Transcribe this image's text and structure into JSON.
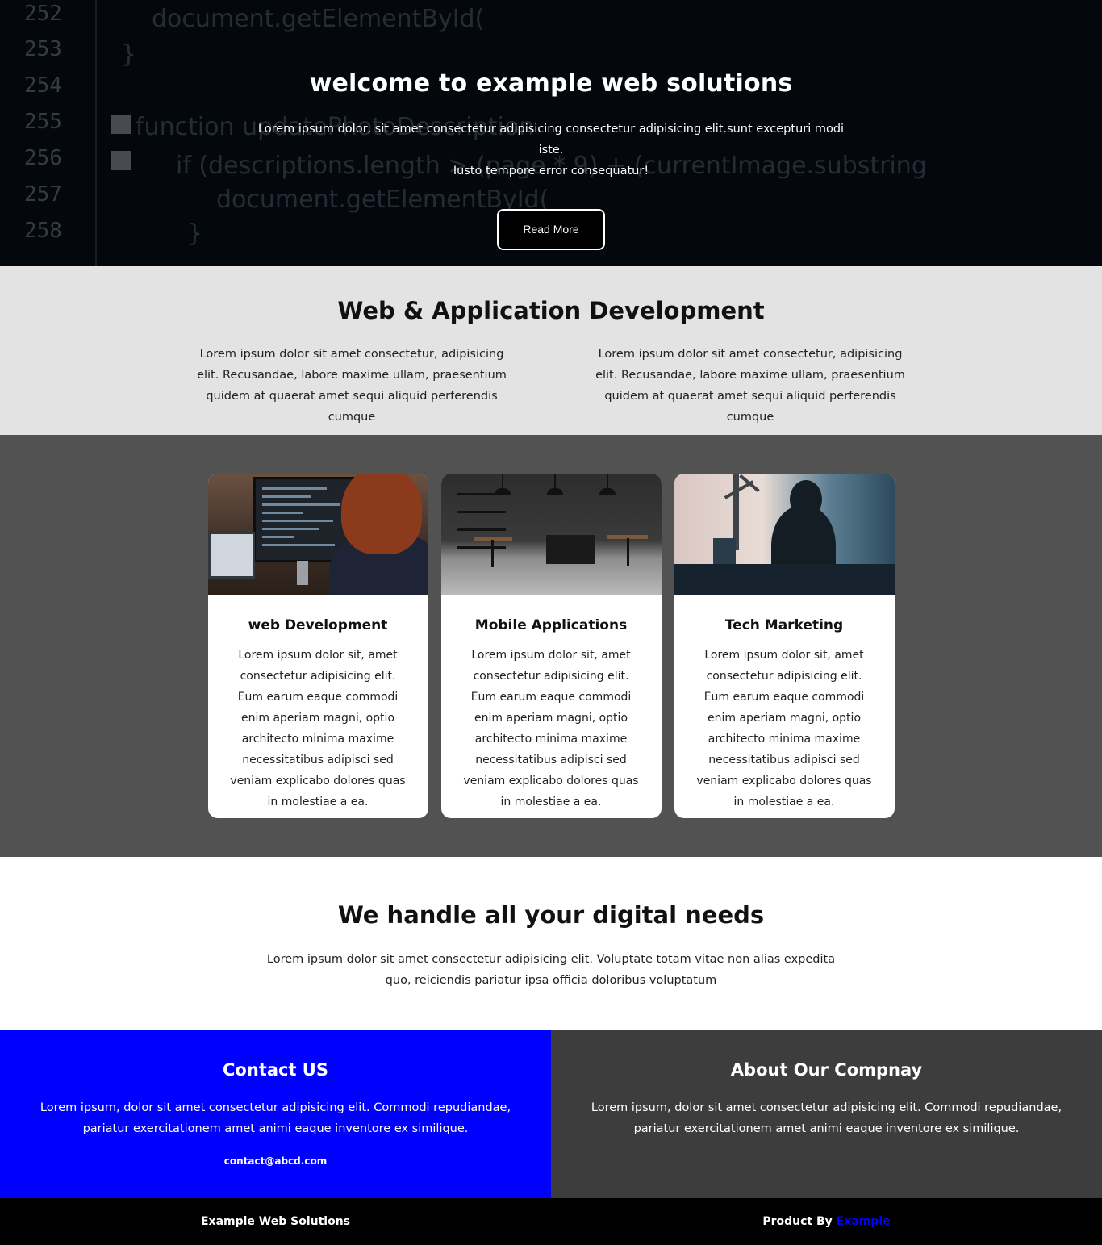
{
  "hero": {
    "title": "welcome to example web solutions",
    "text_line1": "Lorem ipsum dolor, sit amet consectetur adipisicing consectetur adipisicing elit.sunt excepturi modi iste.",
    "text_line2": "Iusto tempore error consequatur!",
    "button": "Read More",
    "code_lines": [
      {
        "no": "252",
        "code": "document.getElementById("
      },
      {
        "no": "253",
        "code": "}"
      },
      {
        "no": "254",
        "code": ""
      },
      {
        "no": "255",
        "code": "function updatePhotoDescription"
      },
      {
        "no": "256",
        "code": "if (descriptions.length > (page * 9) + (currentImage.substring"
      },
      {
        "no": "257",
        "code": "document.getElementById("
      },
      {
        "no": "258",
        "code": "}"
      }
    ]
  },
  "dev": {
    "title": "Web & Application Development",
    "columns": [
      "Lorem ipsum dolor sit amet consectetur, adipisicing elit. Recusandae, labore maxime ullam, praesentium quidem at quaerat amet sequi aliquid perferendis cumque",
      "Lorem ipsum dolor sit amet consectetur, adipisicing elit. Recusandae, labore maxime ullam, praesentium quidem at quaerat amet sequi aliquid perferendis cumque"
    ]
  },
  "cards": [
    {
      "title": "web Development",
      "text": "Lorem ipsum dolor sit, amet consectetur adipisicing elit. Eum earum eaque commodi enim aperiam magni, optio architecto minima maxime necessitatibus adipisci sed veniam explicabo dolores quas in molestiae a ea."
    },
    {
      "title": "Mobile Applications",
      "text": "Lorem ipsum dolor sit, amet consectetur adipisicing elit. Eum earum eaque commodi enim aperiam magni, optio architecto minima maxime necessitatibus adipisci sed veniam explicabo dolores quas in molestiae a ea."
    },
    {
      "title": "Tech Marketing",
      "text": "Lorem ipsum dolor sit, amet consectetur adipisicing elit. Eum earum eaque commodi enim aperiam magni, optio architecto minima maxime necessitatibus adipisci sed veniam explicabo dolores quas in molestiae a ea."
    }
  ],
  "digital": {
    "title": "We handle all your digital needs",
    "text": "Lorem ipsum dolor sit amet consectetur adipisicing elit. Voluptate totam vitae non alias expedita quo, reiciendis pariatur ipsa officia doloribus voluptatum"
  },
  "contact": {
    "title": "Contact US",
    "text": "Lorem ipsum, dolor sit amet consectetur adipisicing elit. Commodi repudiandae, pariatur exercitationem amet animi eaque inventore ex similique.",
    "email": "contact@abcd.com"
  },
  "about": {
    "title": "About Our Compnay",
    "text": "Lorem ipsum, dolor sit amet consectetur adipisicing elit. Commodi repudiandae, pariatur exercitationem amet animi eaque inventore ex similique."
  },
  "footer": {
    "brand": "Example Web Solutions",
    "product_by": "Product By",
    "product_link": "Example"
  },
  "colors": {
    "contact_bg": "#0000ff",
    "about_bg": "#3d3d3d",
    "cards_bg": "#525252",
    "dev_bg": "#e3e3e3",
    "link": "#0000ff"
  }
}
